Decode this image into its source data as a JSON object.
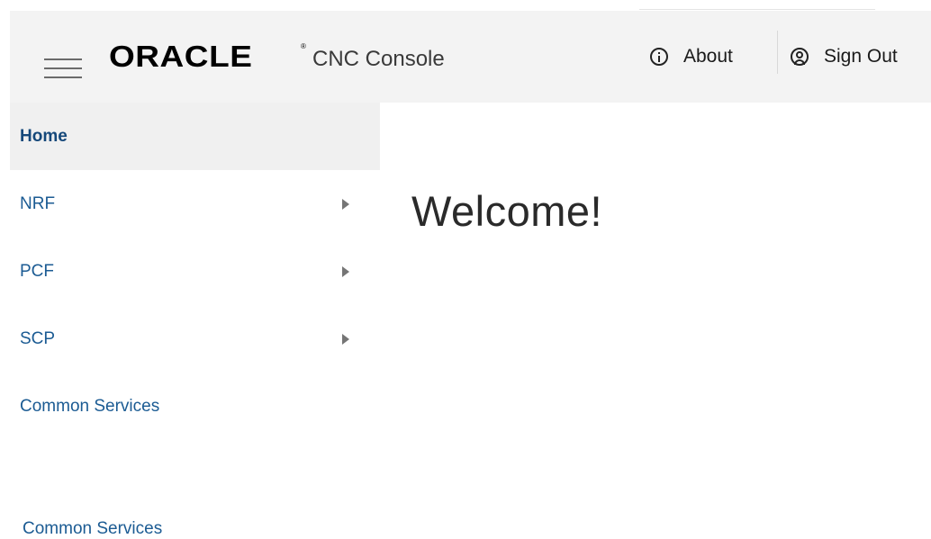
{
  "header": {
    "logo_text": "ORACLE",
    "logo_reg": "®",
    "app_name": "CNC Console",
    "about_label": "About",
    "signout_label": "Sign Out"
  },
  "sidebar": {
    "items": [
      {
        "label": "Home",
        "active": true,
        "has_submenu": false
      },
      {
        "label": "NRF",
        "active": false,
        "has_submenu": true
      },
      {
        "label": "PCF",
        "active": false,
        "has_submenu": true
      },
      {
        "label": "SCP",
        "active": false,
        "has_submenu": true
      },
      {
        "label": "Common Services",
        "active": false,
        "has_submenu": false
      }
    ],
    "footer_label": "Common Services"
  },
  "main": {
    "welcome": "Welcome!"
  },
  "colors": {
    "header_bg": "#f3f3f3",
    "link": "#1b5b93",
    "active_bg": "#f0f0f0"
  }
}
